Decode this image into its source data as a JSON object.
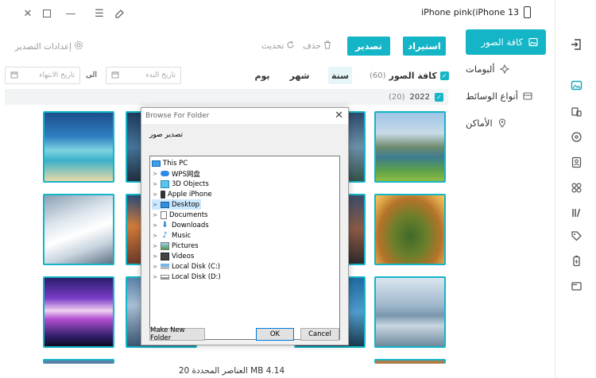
{
  "device": {
    "name": "iPhone pink(iPhone 13"
  },
  "sidebar": {
    "items": [
      {
        "label": "كافة الصور",
        "icon": "image-icon"
      },
      {
        "label": "ألبومات",
        "icon": "album-icon"
      },
      {
        "label": "أنواع الوسائط",
        "icon": "media-types-icon"
      },
      {
        "label": "الأماكن",
        "icon": "location-pin-icon"
      }
    ]
  },
  "toolbar": {
    "import_label": "استيراد",
    "export_label": "تصدير",
    "delete_label": "حذف",
    "refresh_label": "تحديث",
    "export_settings_label": "إعدادات التصدير"
  },
  "filter": {
    "all_photos_label": "كافة الصور",
    "all_photos_count": "(60)",
    "year_label": "سنة",
    "month_label": "شهر",
    "day_label": "يوم",
    "start_date_placeholder": "تاريخ البدء",
    "to_label": "الى",
    "end_date_placeholder": "تاريخ الانتهاء"
  },
  "year_row": {
    "year": "2022",
    "count": "(20)"
  },
  "status": {
    "text": "4.14 MB العناصر المحددة 20"
  },
  "dialog": {
    "title": "Browse For Folder",
    "caption": "تصدير صور",
    "tree": [
      {
        "label": "This PC",
        "icon": "computer-icon",
        "expandable": false
      },
      {
        "label": "WPS网盘",
        "icon": "cloud-icon",
        "expandable": true
      },
      {
        "label": "3D Objects",
        "icon": "cube-icon",
        "expandable": true
      },
      {
        "label": "Apple iPhone",
        "icon": "phone-icon",
        "expandable": true
      },
      {
        "label": "Desktop",
        "icon": "desktop-icon",
        "expandable": true
      },
      {
        "label": "Documents",
        "icon": "documents-icon",
        "expandable": true
      },
      {
        "label": "Downloads",
        "icon": "download-icon",
        "expandable": true
      },
      {
        "label": "Music",
        "icon": "music-icon",
        "expandable": true
      },
      {
        "label": "Pictures",
        "icon": "pictures-icon",
        "expandable": true
      },
      {
        "label": "Videos",
        "icon": "videos-icon",
        "expandable": true
      },
      {
        "label": "Local Disk (C:)",
        "icon": "disk-icon",
        "expandable": true
      },
      {
        "label": "Local Disk (D:)",
        "icon": "disk-icon",
        "expandable": true
      }
    ],
    "new_folder_label": "Make New Folder",
    "ok_label": "OK",
    "cancel_label": "Cancel"
  },
  "colors": {
    "accent": "#13b5c7",
    "selected_row": "#cce8ff"
  }
}
